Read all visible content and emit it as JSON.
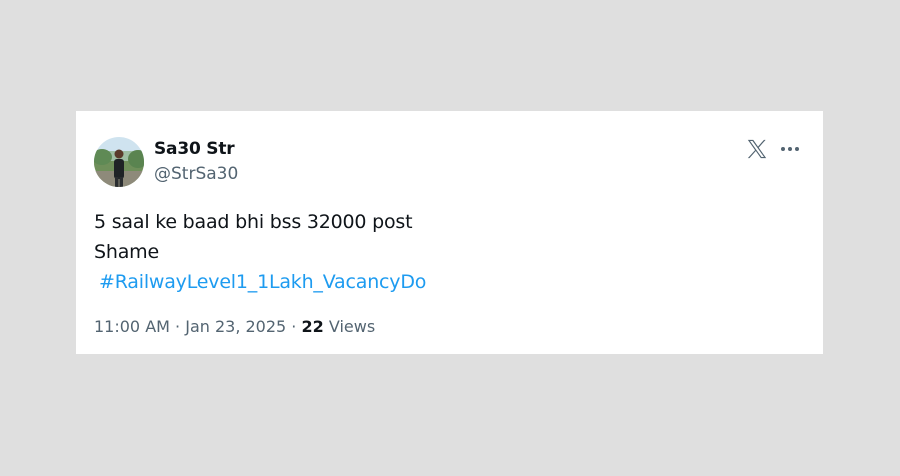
{
  "tweet": {
    "display_name": "Sa30 Str",
    "handle": "@StrSa30",
    "text_lines": [
      "5 saal ke baad bhi bss 32000 post",
      "Shame"
    ],
    "hashtag": "#RailwayLevel1_1Lakh_VacancyDo",
    "time": "11:00 AM",
    "separator": " · ",
    "date": "Jan 23, 2025",
    "views_count": "22",
    "views_label": "Views"
  },
  "icons": {
    "logo": "x-logo-icon",
    "more": "more-dots-icon",
    "avatar": "user-avatar-photo"
  },
  "colors": {
    "page_background": "#dfdfdf",
    "card_background": "#ffffff",
    "text_primary": "#0f1419",
    "text_secondary": "#536471",
    "link": "#1d9bf0"
  }
}
